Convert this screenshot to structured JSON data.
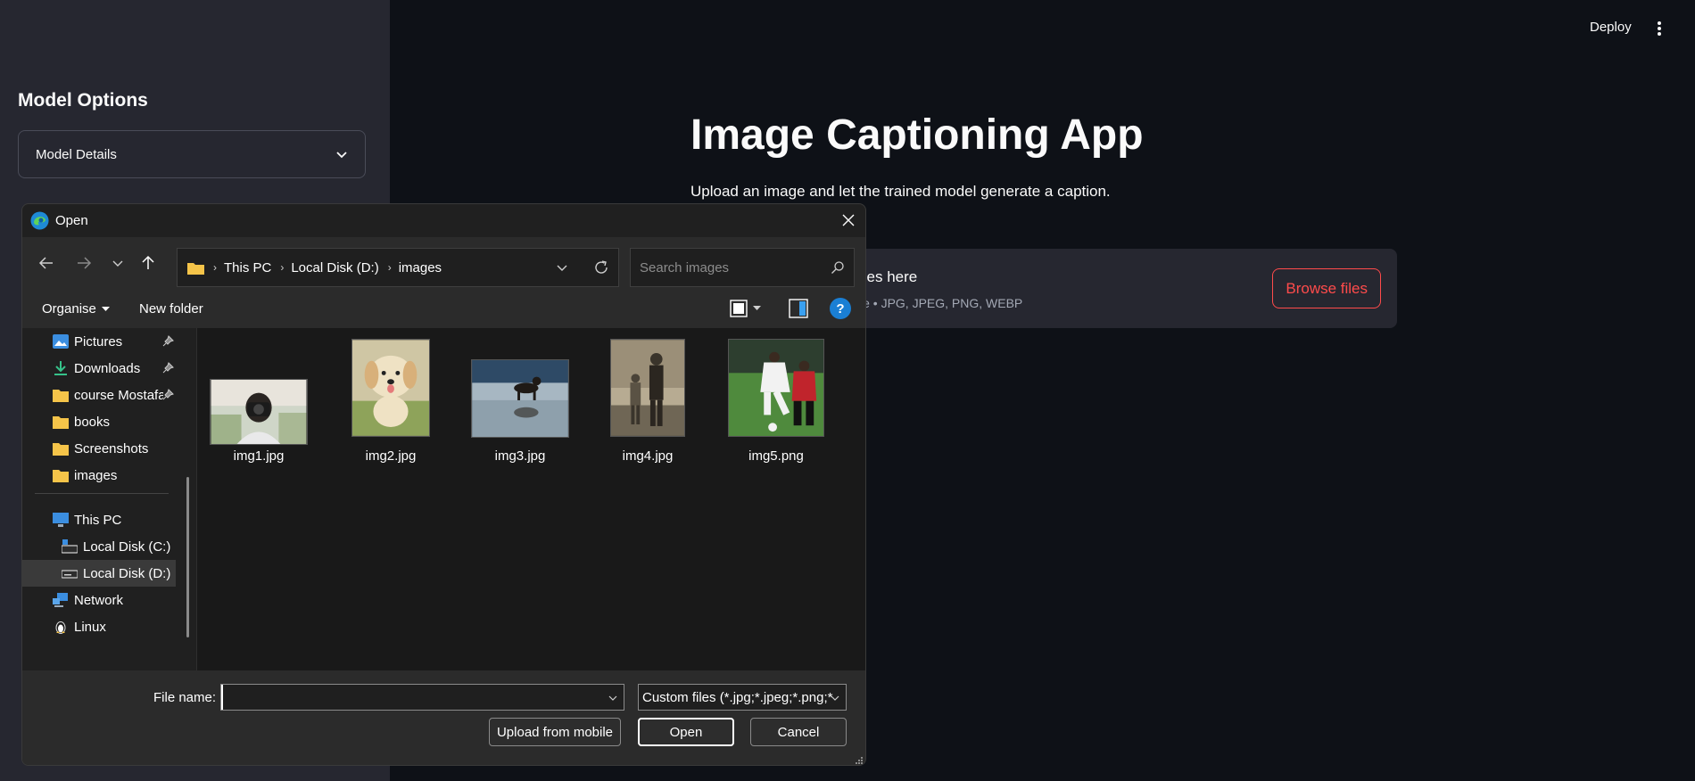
{
  "sidebar": {
    "title": "Model Options",
    "expander_label": "Model Details"
  },
  "header": {
    "deploy_label": "Deploy"
  },
  "main": {
    "title": "Image Captioning App",
    "subtitle": "Upload an image and let the trained model generate a caption.",
    "uploader": {
      "drop_text": "iles here",
      "limit_text": "le • JPG, JPEG, PNG, WEBP",
      "browse_label": "Browse files",
      "accent_color": "#ff4b4b"
    }
  },
  "dialog": {
    "title": "Open",
    "breadcrumb": [
      "This PC",
      "Local Disk (D:)",
      "images"
    ],
    "search_placeholder": "Search images",
    "toolbar": {
      "organise_label": "Organise",
      "new_folder_label": "New folder",
      "help_label": "?"
    },
    "nav_items": [
      {
        "label": "Pictures",
        "icon": "pictures-icon",
        "pinned": true
      },
      {
        "label": "Downloads",
        "icon": "downloads-icon",
        "pinned": true
      },
      {
        "label": "course Mostafa",
        "icon": "folder-icon",
        "pinned": true
      },
      {
        "label": "books",
        "icon": "folder-icon",
        "pinned": false
      },
      {
        "label": "Screenshots",
        "icon": "folder-icon",
        "pinned": false
      },
      {
        "label": "images",
        "icon": "folder-icon",
        "pinned": false
      },
      {
        "label": "This PC",
        "icon": "computer-icon",
        "pinned": false
      },
      {
        "label": "Local Disk (C:)",
        "icon": "drive-c-icon",
        "pinned": false
      },
      {
        "label": "Local Disk (D:)",
        "icon": "drive-icon",
        "pinned": false,
        "selected": true
      },
      {
        "label": "Network",
        "icon": "network-icon",
        "pinned": false
      },
      {
        "label": "Linux",
        "icon": "linux-icon",
        "pinned": false
      }
    ],
    "files": [
      {
        "name": "img1.jpg",
        "thumb": "photographer-thumbnail"
      },
      {
        "name": "img2.jpg",
        "thumb": "puppy-thumbnail"
      },
      {
        "name": "img3.jpg",
        "thumb": "dog-beach-thumbnail"
      },
      {
        "name": "img4.jpg",
        "thumb": "vintage-photo-thumbnail"
      },
      {
        "name": "img5.png",
        "thumb": "football-thumbnail"
      }
    ],
    "file_name_label": "File name:",
    "file_name_value": "",
    "filter_value": "Custom files (*.jpg;*.jpeg;*.png;*",
    "buttons": {
      "upload_mobile": "Upload from mobile",
      "open": "Open",
      "cancel": "Cancel"
    }
  }
}
